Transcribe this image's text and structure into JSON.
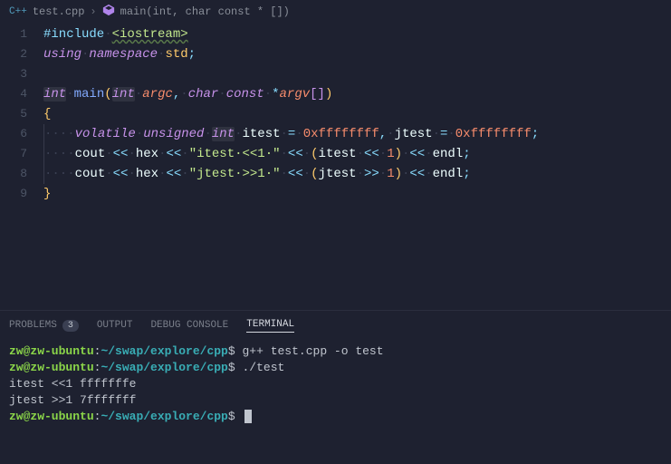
{
  "breadcrumb": {
    "file_icon": "C++",
    "file": "test.cpp",
    "symbol": "main(int, char const * [])"
  },
  "lines": [
    "1",
    "2",
    "3",
    "4",
    "5",
    "6",
    "7",
    "8",
    "9"
  ],
  "code": {
    "l1": {
      "include": "#include",
      "path": "<iostream>"
    },
    "l2": {
      "using": "using",
      "namespace": "namespace",
      "std": "std",
      "semi": ";"
    },
    "l4": {
      "int": "int",
      "main": "main",
      "lp": "(",
      "int2": "int",
      "argc": "argc",
      "comma": ",",
      "char": "char",
      "const": "const",
      "star": "*",
      "argv": "argv",
      "br": "[]",
      "rp": ")"
    },
    "l5": {
      "brace": "{"
    },
    "l6": {
      "volatile": "volatile",
      "unsigned": "unsigned",
      "int": "int",
      "itest": "itest",
      "eq": "=",
      "hex1": "0xffffffff",
      "comma": ",",
      "jtest": "jtest",
      "eq2": "=",
      "hex2": "0xffffffff",
      "semi": ";"
    },
    "l7": {
      "cout": "cout",
      "op1": "<<",
      "hex": "hex",
      "op2": "<<",
      "str": "\"itest·<<1·\"",
      "op3": "<<",
      "lp": "(",
      "itest": "itest",
      "shl": "<<",
      "one": "1",
      "rp": ")",
      "op4": "<<",
      "endl": "endl",
      "semi": ";"
    },
    "l8": {
      "cout": "cout",
      "op1": "<<",
      "hex": "hex",
      "op2": "<<",
      "str": "\"jtest·>>1·\"",
      "op3": "<<",
      "lp": "(",
      "jtest": "jtest",
      "shr": ">>",
      "one": "1",
      "rp": ")",
      "op4": "<<",
      "endl": "endl",
      "semi": ";"
    },
    "l9": {
      "brace": "}"
    }
  },
  "tabs": {
    "problems": "PROBLEMS",
    "problems_badge": "3",
    "output": "OUTPUT",
    "debug": "DEBUG CONSOLE",
    "terminal": "TERMINAL"
  },
  "terminal": {
    "prompt_user": "zw@zw-ubuntu",
    "prompt_sep": ":",
    "prompt_path": "~/swap/explore/cpp",
    "prompt_end": "$",
    "cmd1": "g++ test.cpp -o test",
    "cmd2": "./test",
    "out1": "itest <<1 fffffffe",
    "out2": "jtest >>1 7fffffff"
  }
}
